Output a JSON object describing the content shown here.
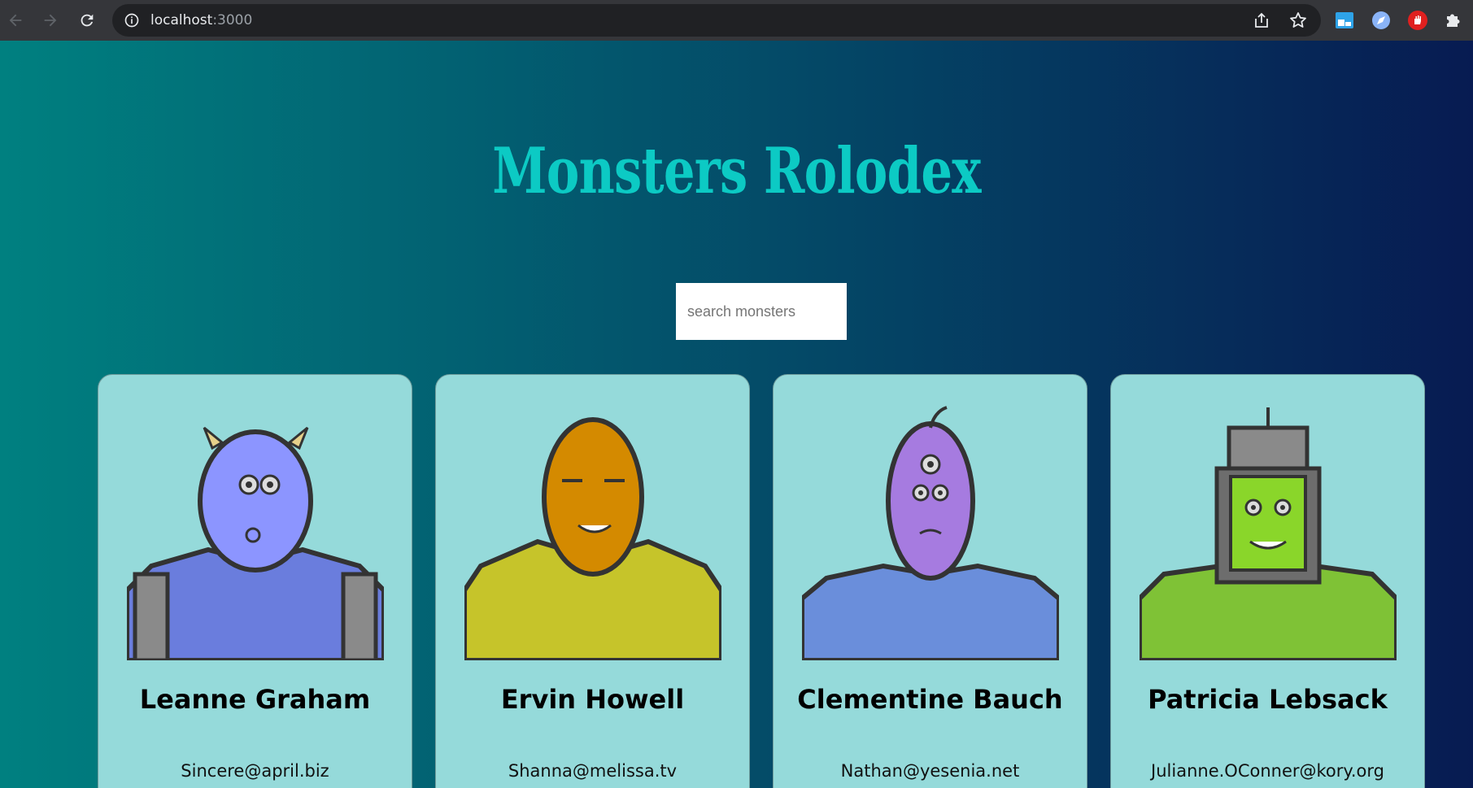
{
  "browser": {
    "url_host": "localhost",
    "url_port": ":3000"
  },
  "app": {
    "title": "Monsters Rolodex",
    "search_placeholder": "search monsters"
  },
  "monsters": [
    {
      "name": "Leanne Graham",
      "email": "Sincere@april.biz",
      "color": "#8c95ff"
    },
    {
      "name": "Ervin Howell",
      "email": "Shanna@melissa.tv",
      "color": "#d48a00"
    },
    {
      "name": "Clementine Bauch",
      "email": "Nathan@yesenia.net",
      "color": "#a67be0"
    },
    {
      "name": "Patricia Lebsack",
      "email": "Julianne.OConner@kory.org",
      "color": "#8ad62a"
    }
  ]
}
